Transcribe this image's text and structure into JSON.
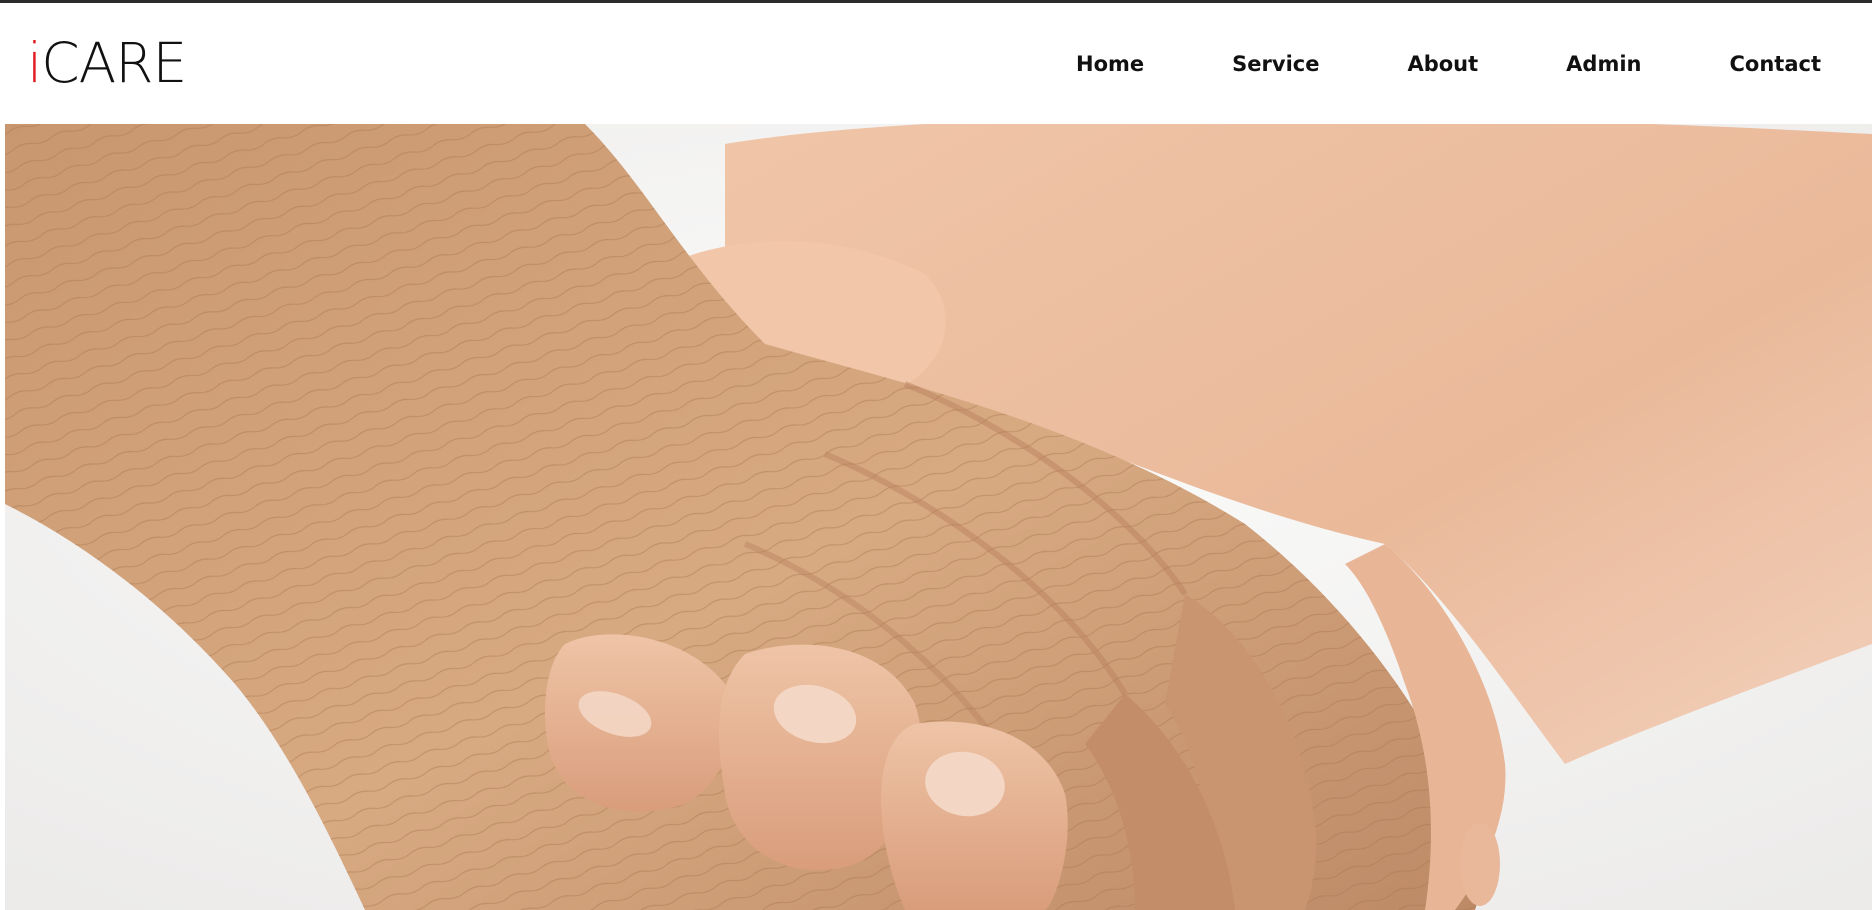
{
  "logo": {
    "accent": "i",
    "main": "CARE",
    "accent_color": "#e21d23"
  },
  "nav": {
    "items": [
      {
        "label": "Home"
      },
      {
        "label": "Service"
      },
      {
        "label": "About"
      },
      {
        "label": "Admin"
      },
      {
        "label": "Contact"
      }
    ]
  },
  "hero": {
    "image_icon": "holding-hands-photo"
  }
}
